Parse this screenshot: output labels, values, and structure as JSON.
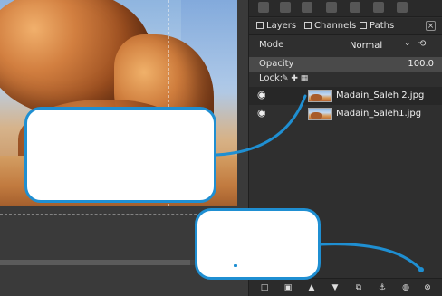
{
  "panel": {
    "tabs": [
      {
        "label": "Layers"
      },
      {
        "label": "Channels"
      },
      {
        "label": "Paths"
      }
    ],
    "mode": {
      "label": "Mode",
      "value": "Normal"
    },
    "opacity": {
      "label": "Opacity",
      "value": "100.0"
    },
    "lock": {
      "label": "Lock:"
    },
    "layers": [
      {
        "name": "Madain_Saleh 2.jpg"
      },
      {
        "name": "Madain_Saleh1.jpg"
      }
    ]
  },
  "icons": {
    "visibility": "eye-icon",
    "close": "close-icon",
    "dropdown": "chevron-down-icon",
    "reset": "reset-icon"
  },
  "colors": {
    "callout_border": "#1f8fd2",
    "panel_background": "#2f2f2f",
    "canvas_background": "#3a3a3a"
  }
}
